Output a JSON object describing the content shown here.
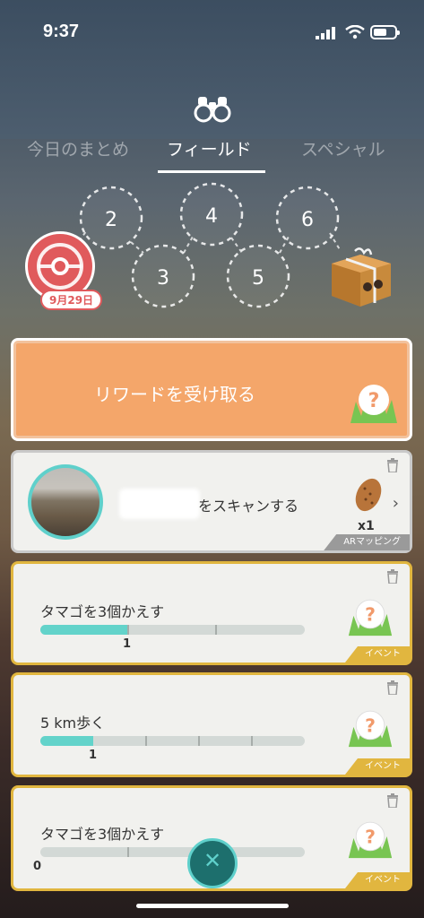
{
  "status": {
    "time": "9:37"
  },
  "tabs": [
    {
      "label": "今日のまとめ"
    },
    {
      "label": "フィールド"
    },
    {
      "label": "スペシャル"
    }
  ],
  "stamp": {
    "date": "9月29日"
  },
  "path_nodes": [
    "2",
    "3",
    "4",
    "5",
    "6"
  ],
  "reward": {
    "label": "リワードを受け取る"
  },
  "tasks": [
    {
      "title": "をスキャンする",
      "reward_count": "x1",
      "tag": "ARマッピング"
    },
    {
      "title": "タマゴを3個かえす",
      "progress": 1,
      "progress_max": 3,
      "value": "1",
      "tag": "イベント"
    },
    {
      "title": "5 km歩く",
      "progress": 1,
      "progress_max": 5,
      "value": "1",
      "tag": "イベント"
    },
    {
      "title": "タマゴを3個かえす",
      "progress": 0,
      "progress_max": 3,
      "value": "0",
      "tag": "イベント"
    }
  ],
  "colors": {
    "accent": "#63d3ca",
    "reward_card": "#f4a66a",
    "event_tag": "#e1b63f",
    "stamp": "#e05a5c"
  }
}
